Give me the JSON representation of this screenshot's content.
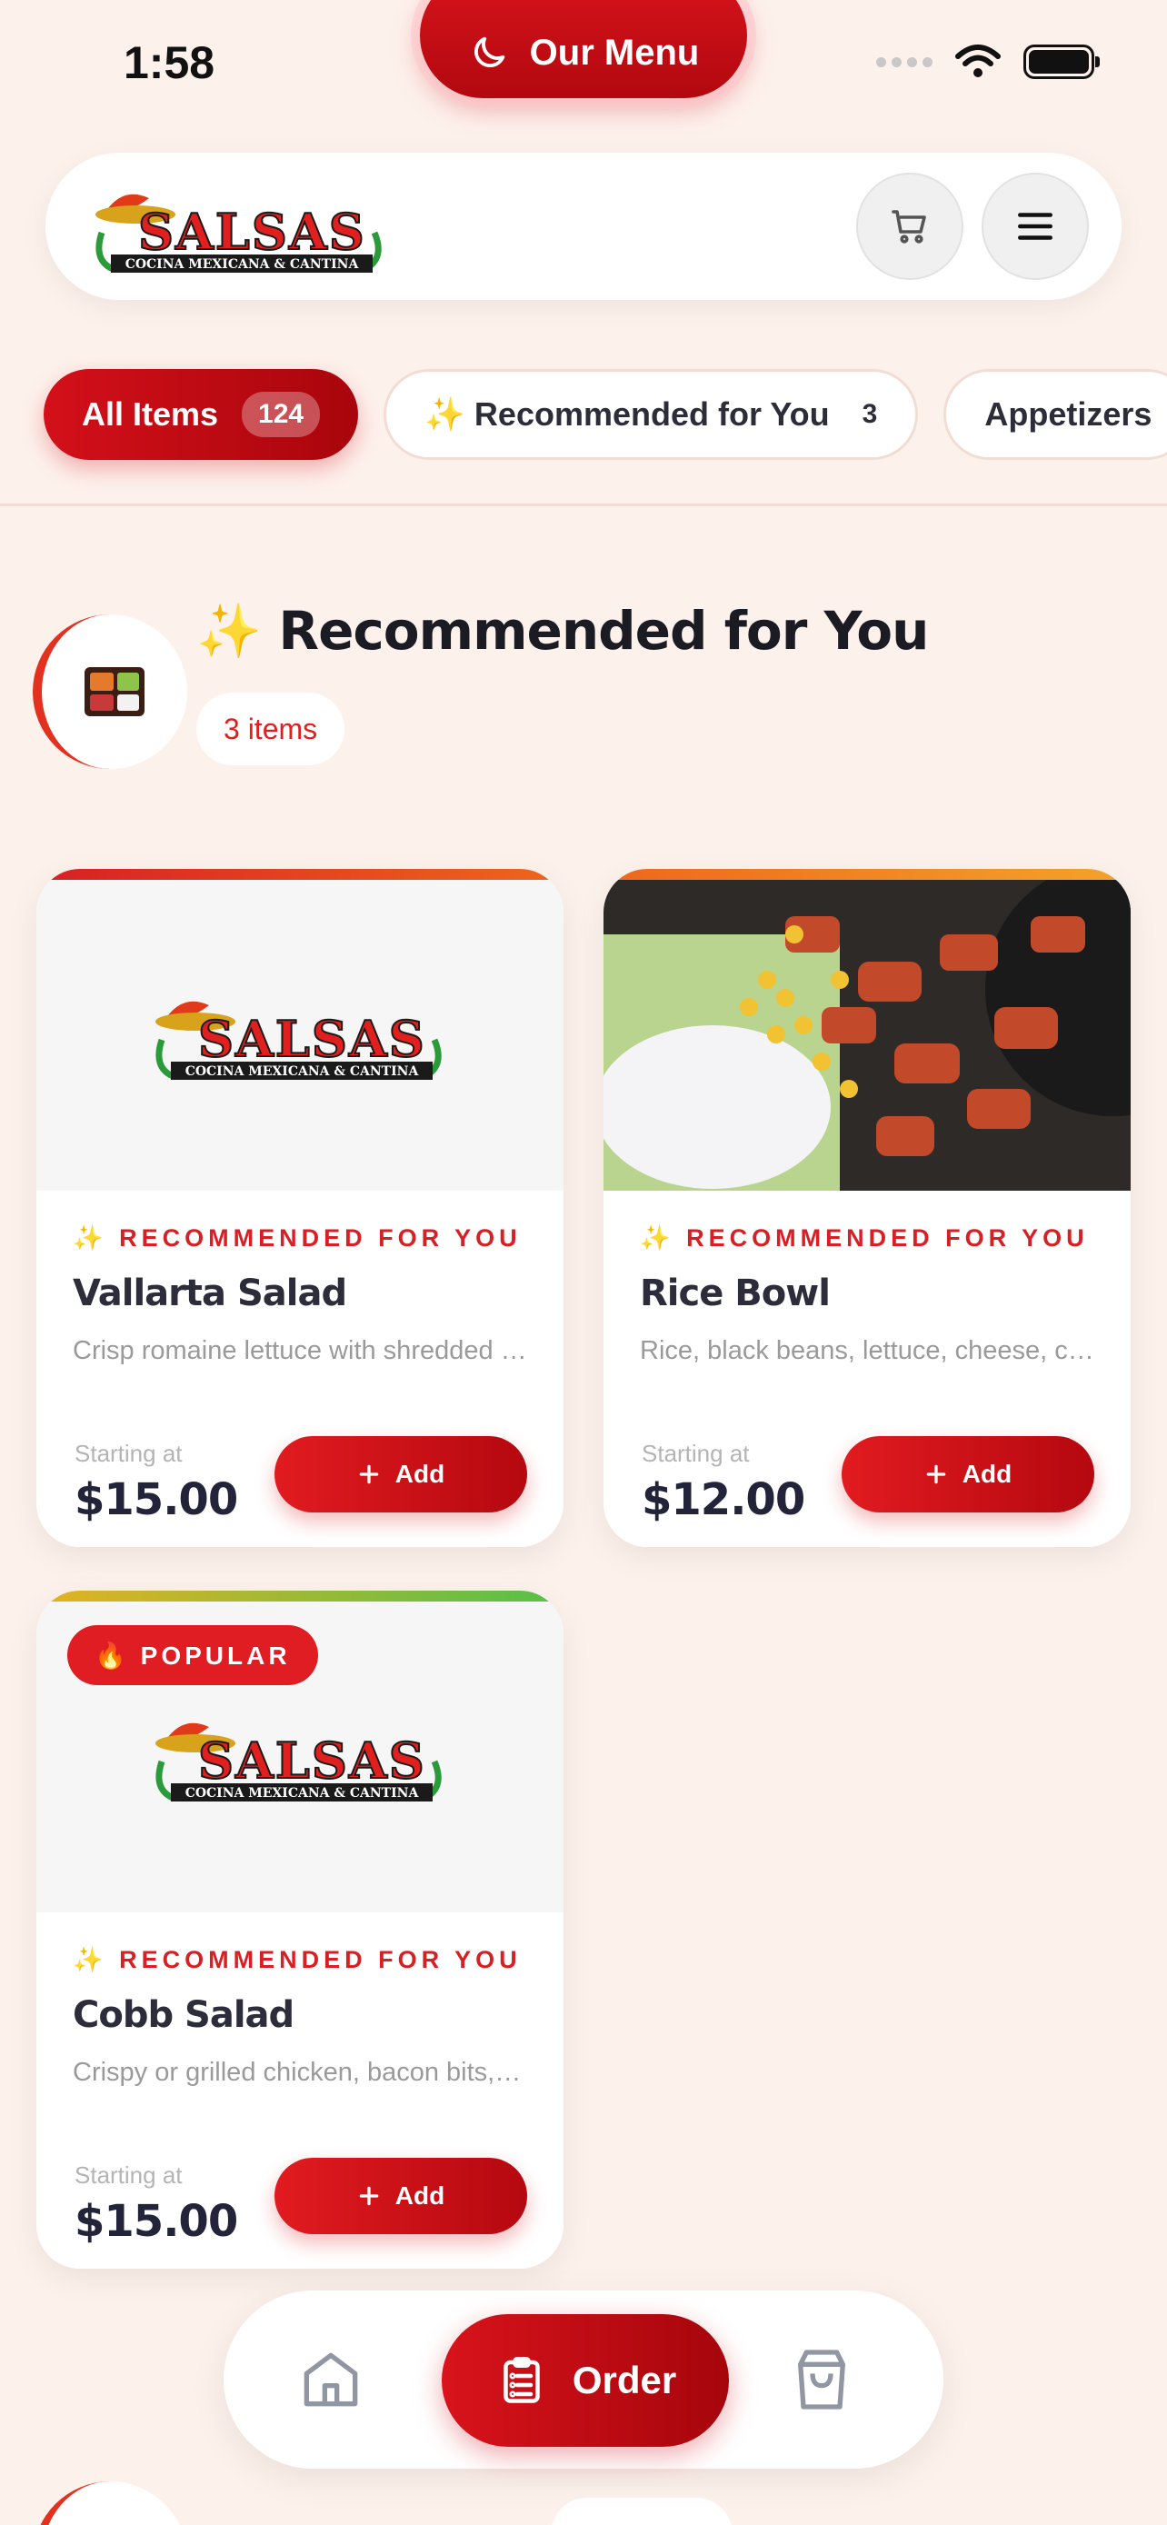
{
  "status_bar": {
    "time": "1:58"
  },
  "top_pill": {
    "label": "Our Menu",
    "icon": "moon-icon"
  },
  "header": {
    "logo_text": "SALSAS",
    "logo_subtitle": "COCINA MEXICANA & CANTINA"
  },
  "categories": [
    {
      "label": "All Items",
      "count": "124",
      "active": true
    },
    {
      "label": "✨ Recommended for You",
      "count": "3",
      "active": false
    },
    {
      "label": "Appetizers",
      "count": "",
      "active": false
    }
  ],
  "section": {
    "title": "✨ Recommended for You",
    "badge": "3 items",
    "icon": "bento-box-icon"
  },
  "cards": [
    {
      "tag": "✨ RECOMMENDED FOR YOU",
      "name": "Vallarta Salad",
      "description": "Crisp romaine lettuce with shredded cheese",
      "price_label": "Starting at",
      "price": "$15.00",
      "add_label": "Add",
      "image": "logo",
      "bar_color": "#e53a1f"
    },
    {
      "tag": "✨ RECOMMENDED FOR YOU",
      "name": "Rice Bowl",
      "description": "Rice, black beans, lettuce, cheese, corn",
      "price_label": "Starting at",
      "price": "$12.00",
      "add_label": "Add",
      "image": "food-photo",
      "bar_color": "#f08a1c"
    },
    {
      "badge": "🔥 POPULAR",
      "tag": "✨ RECOMMENDED FOR YOU",
      "name": "Cobb Salad",
      "description": "Crispy or grilled chicken, bacon bits, egg",
      "price_label": "Starting at",
      "price": "$15.00",
      "add_label": "Add",
      "image": "logo",
      "bar_color": "#8fc43a"
    }
  ],
  "bottom_nav": {
    "home_icon": "home-icon",
    "order_label": "Order",
    "bag_icon": "shopping-bag-icon"
  },
  "colors": {
    "brand_red": "#d8131b",
    "background": "#fdf1ec"
  }
}
